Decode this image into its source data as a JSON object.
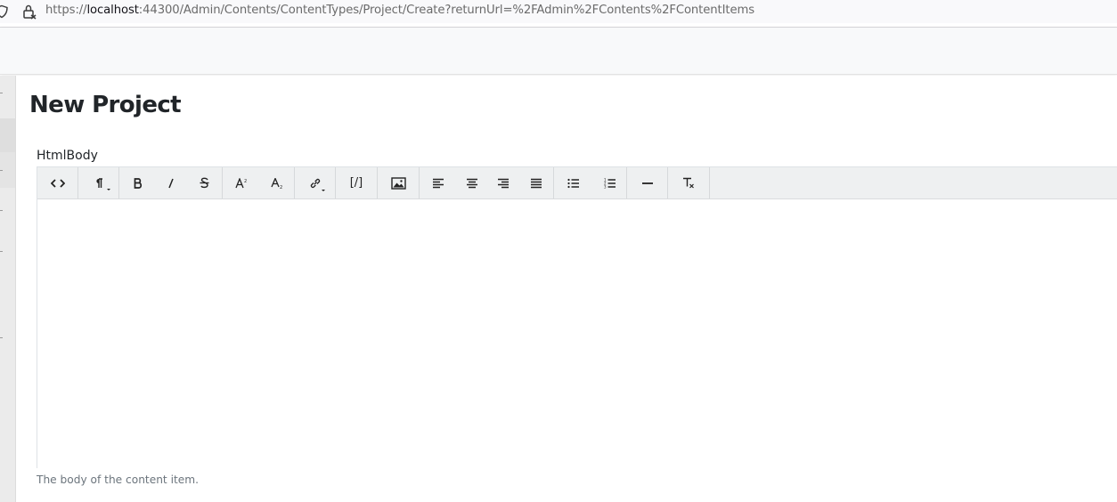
{
  "browser": {
    "url_scheme": "https://",
    "url_host": "localhost",
    "url_rest": ":44300/Admin/Contents/ContentTypes/Project/Create?returnUrl=%2FAdmin%2FContents%2FContentItems"
  },
  "page": {
    "title": "New Project"
  },
  "field": {
    "label": "HtmlBody",
    "hint": "The body of the content item."
  },
  "toolbar": {
    "groups": [
      [
        "code-view-icon"
      ],
      [
        "paragraph-format-icon"
      ],
      [
        "bold-icon",
        "italic-icon",
        "strikethrough-icon"
      ],
      [
        "superscript-icon",
        "subscript-icon"
      ],
      [
        "insert-link-icon"
      ],
      [
        "shortcode-icon"
      ],
      [
        "insert-image-icon"
      ],
      [
        "align-left-icon",
        "align-center-icon",
        "align-right-icon",
        "align-justify-icon"
      ],
      [
        "bulleted-list-icon",
        "numbered-list-icon"
      ],
      [
        "horizontal-rule-icon"
      ],
      [
        "clear-formatting-icon"
      ]
    ],
    "shortcode_label": "[/]"
  }
}
